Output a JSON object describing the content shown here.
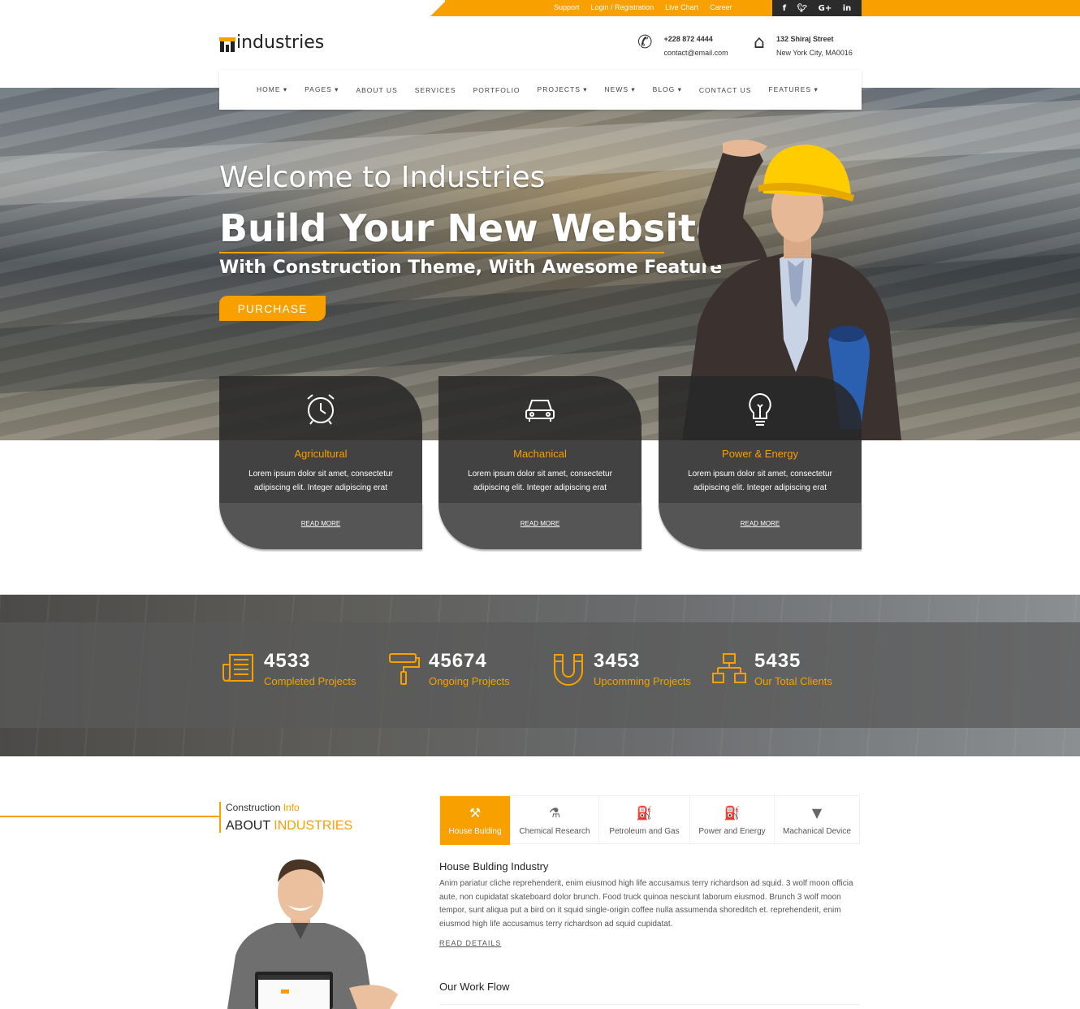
{
  "topbar": {
    "links": [
      "Support",
      "Login / Registration",
      "Live Chart",
      "Career"
    ],
    "social": [
      "f",
      "t",
      "G+",
      "in"
    ]
  },
  "header": {
    "logo_text": "industries",
    "phone": "+228 872 4444",
    "email": "contact@email.com",
    "address_line1": "132 Shiraj Street",
    "address_line2": "New York City, MA0016"
  },
  "nav": {
    "items": [
      "HOME ▾",
      "PAGES ▾",
      "ABOUT US",
      "SERVICES",
      "PORTFOLIO",
      "PROJECTS ▾",
      "NEWS ▾",
      "BLOG ▾",
      "CONTACT US",
      "FEATURES ▾"
    ]
  },
  "hero": {
    "welcome": "Welcome to Industries",
    "headline": "Build Your New Website",
    "subline": "With Construction Theme, With Awesome Feature",
    "button": "PURCHASE"
  },
  "services": [
    {
      "icon": "alarm-clock-icon",
      "title": "Agricultural",
      "desc": "Lorem ipsum dolor sit amet, consectetur adipiscing elit. Integer adipiscing erat",
      "more": "READ MORE"
    },
    {
      "icon": "car-icon",
      "title": "Machanical",
      "desc": "Lorem ipsum dolor sit amet, consectetur adipiscing elit. Integer adipiscing erat",
      "more": "READ MORE"
    },
    {
      "icon": "lightbulb-icon",
      "title": "Power & Energy",
      "desc": "Lorem ipsum dolor sit amet, consectetur adipiscing elit. Integer adipiscing erat",
      "more": "READ MORE"
    }
  ],
  "counters": [
    {
      "icon": "newspaper-icon",
      "value": "4533",
      "label": "Completed Projects"
    },
    {
      "icon": "paint-roller-icon",
      "value": "45674",
      "label": "Ongoing Projects"
    },
    {
      "icon": "magnet-icon",
      "value": "3453",
      "label": "Upcomming Projects"
    },
    {
      "icon": "sitemap-icon",
      "value": "5435",
      "label": "Our Total Clients"
    }
  ],
  "about": {
    "sub_a": "Construction ",
    "sub_b": "Info",
    "title_a": "ABOUT ",
    "title_b": "INDUSTRIES"
  },
  "tabs": [
    {
      "icon": "gavel-icon",
      "glyph": "⚒",
      "label": "House Bulding"
    },
    {
      "icon": "flask-icon",
      "glyph": "⚗",
      "label": "Chemical Research"
    },
    {
      "icon": "fire-extinguisher-icon",
      "glyph": "⛽",
      "label": "Petroleum and Gas"
    },
    {
      "icon": "fire-extinguisher-icon",
      "glyph": "⛽",
      "label": "Power and Energy"
    },
    {
      "icon": "filter-icon",
      "glyph": "▼",
      "label": "Machanical Device"
    }
  ],
  "content": {
    "heading": "House Bulding Industry",
    "text": "Anim pariatur cliche reprehenderit, enim eiusmod high life accusamus terry richardson ad squid. 3 wolf moon officia aute, non cupidatat skateboard dolor brunch. Food truck quinoa nesciunt laborum eiusmod. Brunch 3 wolf moon tempor, sunt aliqua put a bird on it squid single-origin coffee nulla assumenda shoreditch et. reprehenderit, enim eiusmod high life accusamus terry richardson ad squid cupidatat.",
    "read": "READ DETAILS",
    "workflow": "Our Work Flow"
  },
  "colors": {
    "accent": "#f7a000",
    "dark": "#2b2b2b"
  }
}
